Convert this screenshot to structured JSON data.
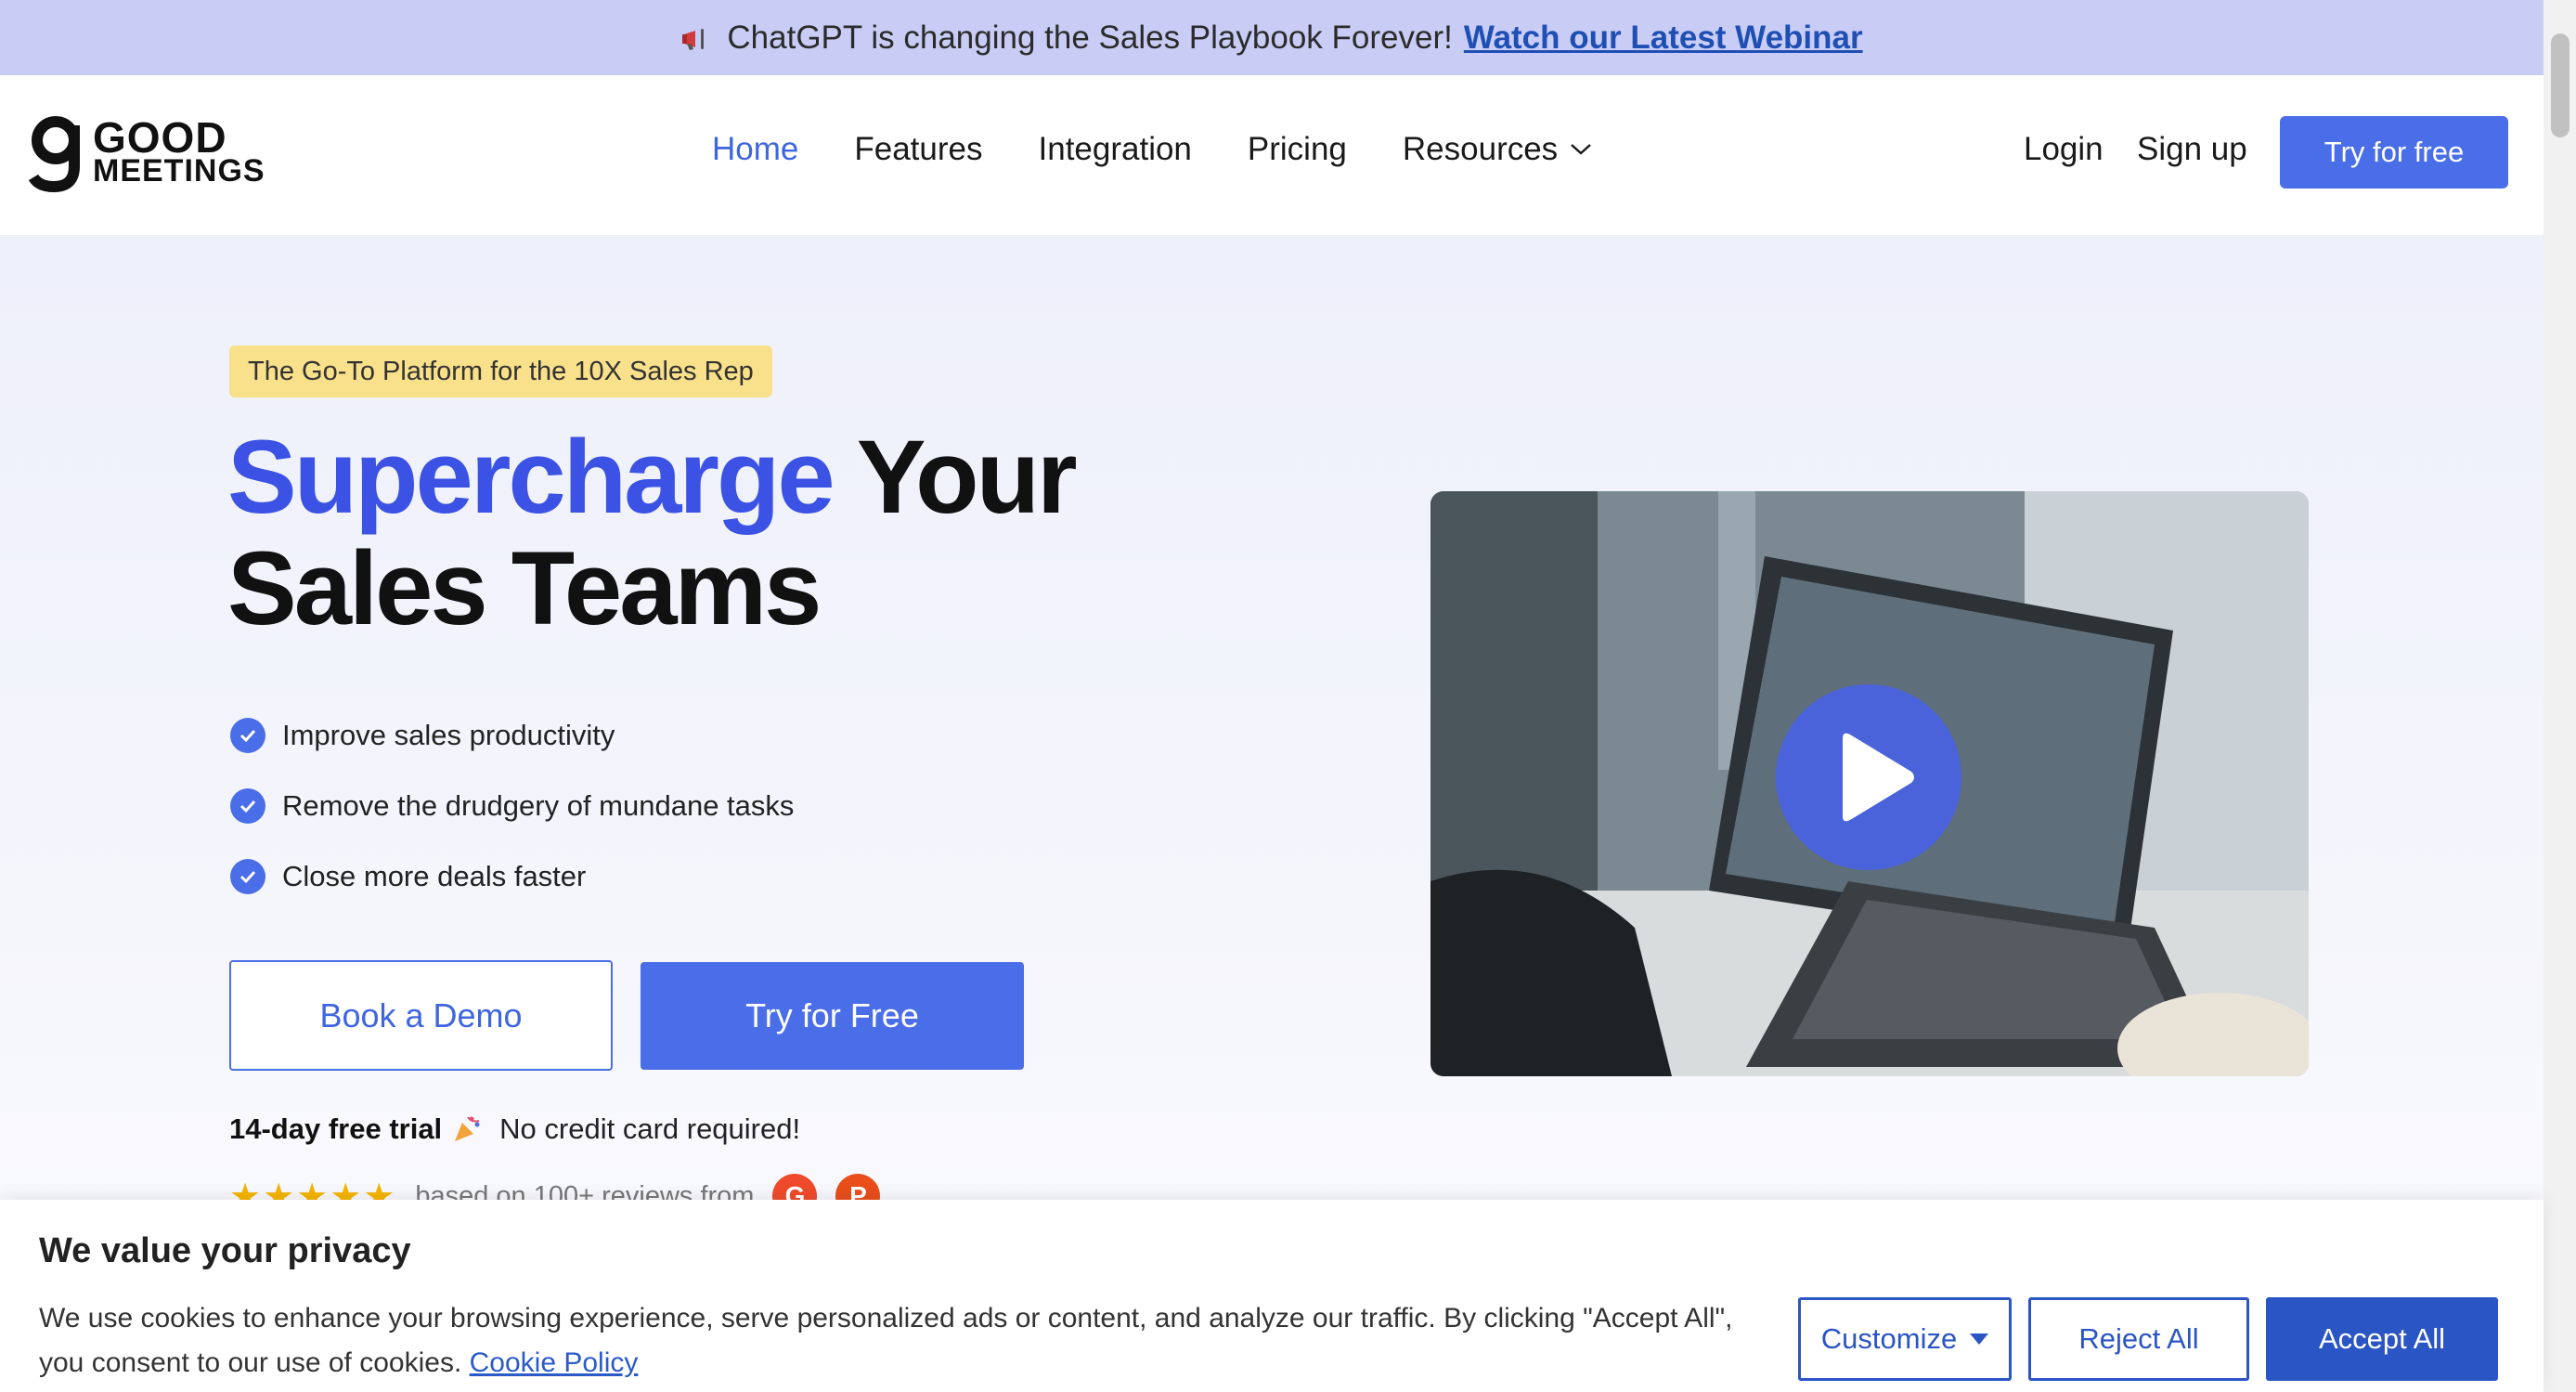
{
  "announcement": {
    "text": "ChatGPT is changing the Sales Playbook Forever!",
    "link": "Watch our Latest Webinar"
  },
  "logo": {
    "line1": "GOOD",
    "line2": "MEETINGS"
  },
  "nav": {
    "home": "Home",
    "features": "Features",
    "integration": "Integration",
    "pricing": "Pricing",
    "resources": "Resources"
  },
  "header": {
    "login": "Login",
    "signup": "Sign up",
    "try": "Try for free"
  },
  "hero": {
    "tag": "The Go-To Platform for the 10X Sales Rep",
    "title_accent": "Supercharge",
    "title_rest1": " Your",
    "title_line2": "Sales Teams",
    "bullets": [
      "Improve sales productivity",
      "Remove the drudgery of mundane tasks",
      "Close more deals faster"
    ],
    "book_demo": "Book a Demo",
    "try_free": "Try for Free",
    "trial_bold": "14-day free trial",
    "trial_rest": "No credit card required!",
    "stars": "★★★★★",
    "reviews_text": "based on 100+ reviews from",
    "rev_g2": "G",
    "rev_p": "P"
  },
  "cookie": {
    "title": "We value your privacy",
    "text": "We use cookies to enhance your browsing experience, serve personalized ads or content, and analyze our traffic. By clicking \"Accept All\", you consent to our use of cookies.",
    "policy": "Cookie Policy",
    "customize": "Customize",
    "reject": "Reject All",
    "accept": "Accept All"
  },
  "colors": {
    "accent": "#4a6ee8",
    "title_accent": "#3b52e4",
    "announce_bg": "#c9cdf6",
    "cookie_blue": "#2a55c4",
    "tag_bg": "#f9e08a"
  }
}
